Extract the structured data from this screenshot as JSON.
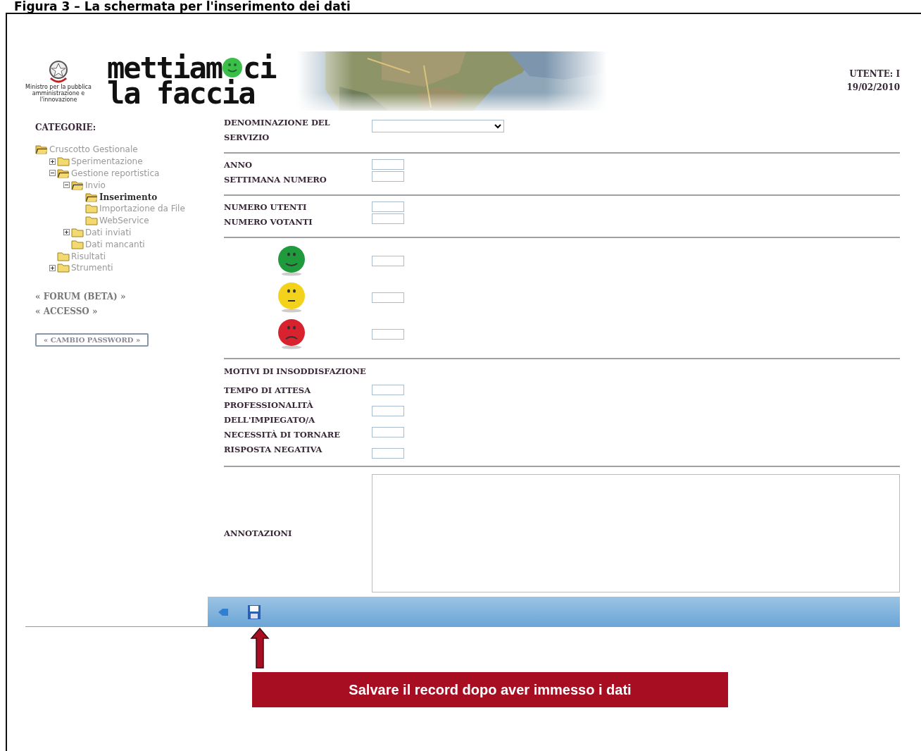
{
  "caption": "Figura 3 – La schermata per l'inserimento dei dati",
  "header": {
    "ministry": "Ministro per la pubblica amministrazione e l'innovazione",
    "logo_part_1": "mettiam",
    "logo_part_2": "ci",
    "logo_line_2": "la faccia",
    "user_label": "UTENTE: I",
    "date": "19/02/2010"
  },
  "sidebar": {
    "title": "CATEGORIE:",
    "tree": [
      {
        "label": "Cruscotto Gestionale",
        "kind": "root",
        "selected": false,
        "children": [
          {
            "label": "Sperimentazione",
            "kind": "branch",
            "expanded": false,
            "selected": false
          },
          {
            "label": "Gestione reportistica",
            "kind": "branch",
            "expanded": true,
            "selected": false,
            "children": [
              {
                "label": "Invio",
                "kind": "branch",
                "expanded": true,
                "selected": false,
                "children": [
                  {
                    "label": "Inserimento",
                    "kind": "leaf",
                    "selected": true
                  },
                  {
                    "label": "Importazione da File",
                    "kind": "leaf",
                    "selected": false
                  },
                  {
                    "label": "WebService",
                    "kind": "leaf",
                    "selected": false
                  }
                ]
              },
              {
                "label": "Dati inviati",
                "kind": "branch",
                "expanded": false,
                "selected": false
              },
              {
                "label": "Dati mancanti",
                "kind": "leaf",
                "selected": false
              }
            ]
          },
          {
            "label": "Risultati",
            "kind": "leaf",
            "selected": false
          },
          {
            "label": "Strumenti",
            "kind": "branch",
            "expanded": false,
            "selected": false
          }
        ]
      }
    ],
    "links": [
      "« FORUM (BETA) »",
      "« ACCESSO »"
    ],
    "button": "« CAMBIO PASSWORD »"
  },
  "form": {
    "service": {
      "label": "DENOMINAZIONE DEL SERVIZIO"
    },
    "group_1": [
      "ANNO",
      "SETTIMANA NUMERO"
    ],
    "group_2": [
      "NUMERO UTENTI",
      "NUMERO VOTANTI"
    ],
    "ratings": [
      {
        "kind": "happy",
        "color": "#1f9a3c"
      },
      {
        "kind": "neutral",
        "color": "#f2d21a"
      },
      {
        "kind": "sad",
        "color": "#d8232e"
      }
    ],
    "reasons_title": "MOTIVI DI INSODDISFAZIONE",
    "reasons": [
      "TEMPO DI ATTESA",
      "PROFESSIONALITÀ DELL'IMPIEGATO/A",
      "NECESSITÀ DI TORNARE",
      "RISPOSTA NEGATIVA"
    ],
    "notes_label": "ANNOTAZIONI"
  },
  "callout": "Salvare il record dopo aver immesso i dati"
}
